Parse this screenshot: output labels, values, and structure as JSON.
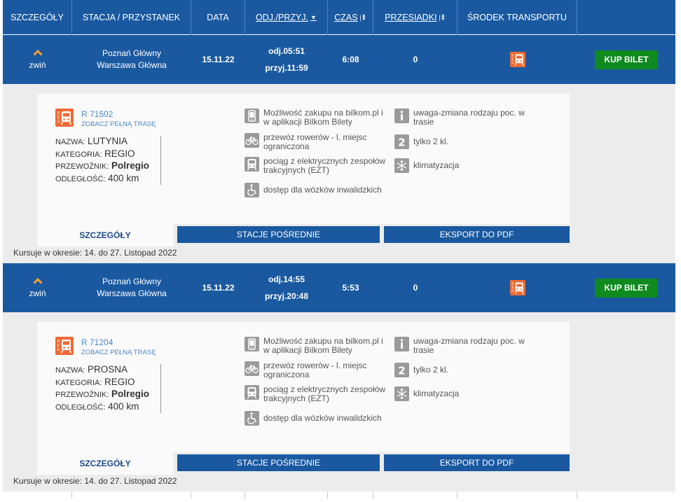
{
  "header": {
    "columns": [
      {
        "label": "SZCZEGÓŁY",
        "sortable": false
      },
      {
        "label": "STACJA / PRZYSTANEK",
        "sortable": false
      },
      {
        "label": "DATA",
        "sortable": false
      },
      {
        "label": "ODJ./PRZYJ.",
        "sortable": true,
        "arrow": "▼"
      },
      {
        "label": "CZAS",
        "sortable": true,
        "arrow": "▲▼"
      },
      {
        "label": "PRZESIADKI",
        "sortable": true,
        "arrow": "▲▼"
      },
      {
        "label": "ŚRODEK TRANSPORTU",
        "sortable": false
      },
      {
        "label": "",
        "sortable": false
      }
    ]
  },
  "colors": {
    "primary": "#1a59a0",
    "buy": "#0e8a1e",
    "link": "#4b87c7",
    "regio": "#ee6b35"
  },
  "trips": [
    {
      "collapse_label": "zwiń",
      "from": "Poznań Główny",
      "to": "Warszawa Główna",
      "date": "15.11.22",
      "departure": "odj.05:51",
      "arrival": "przyj.11:59",
      "duration": "6:08",
      "changes": "0",
      "transport_icon": "regio-train-icon",
      "buy_label": "KUP BILET",
      "details": {
        "train_number": "R 71502",
        "route_link": "ZOBACZ PEŁNĄ TRASĘ",
        "name_label": "NAZWA:",
        "name": "LUTYNIA",
        "category_label": "KATEGORIA:",
        "category": "REGIO",
        "carrier_label": "PRZEWOŹNIK:",
        "carrier": "Polregio",
        "distance_label": "ODLEGŁOŚĆ:",
        "distance": "400  km",
        "features": [
          {
            "icon": "mobile-phone-icon",
            "text": "Możliwość zakupu na bilkom.pl i w aplikacji Bilkom Bilety"
          },
          {
            "icon": "bicycle-icon",
            "text": "przewóz rowerów - l. miejsc ograniczona"
          },
          {
            "icon": "ezt-train-icon",
            "text": "pociąg z elektrycznych zespołów trakcyjnych (EZT)"
          },
          {
            "icon": "wheelchair-icon",
            "text": "dostęp dla wózków inwalidzkich"
          },
          {
            "icon": "info-icon",
            "text": "uwaga-zmiana rodzaju poc. w trasie"
          },
          {
            "icon": "second-class-icon",
            "text": "tylko 2 kl."
          },
          {
            "icon": "snowflake-icon",
            "text": "klimatyzacja"
          }
        ],
        "tabs": {
          "details": "SZCZEGÓŁY",
          "stations": "STACJE POŚREDNIE",
          "pdf": "EKSPORT DO PDF"
        },
        "period": "Kursuje w okresie: 14. do 27. Listopad 2022"
      }
    },
    {
      "collapse_label": "zwiń",
      "from": "Poznań Główny",
      "to": "Warszawa Główna",
      "date": "15.11.22",
      "departure": "odj.14:55",
      "arrival": "przyj.20:48",
      "duration": "5:53",
      "changes": "0",
      "transport_icon": "regio-train-icon",
      "buy_label": "KUP BILET",
      "details": {
        "train_number": "R 71204",
        "route_link": "ZOBACZ PEŁNĄ TRASĘ",
        "name_label": "NAZWA:",
        "name": "PROSNA",
        "category_label": "KATEGORIA:",
        "category": "REGIO",
        "carrier_label": "PRZEWOŹNIK:",
        "carrier": "Polregio",
        "distance_label": "ODLEGŁOŚĆ:",
        "distance": "400  km",
        "features": [
          {
            "icon": "mobile-phone-icon",
            "text": "Możliwość zakupu na bilkom.pl i w aplikacji Bilkom Bilety"
          },
          {
            "icon": "bicycle-icon",
            "text": "przewóz rowerów - l. miejsc ograniczona"
          },
          {
            "icon": "ezt-train-icon",
            "text": "pociąg z elektrycznych zespołów trakcyjnych (EZT)"
          },
          {
            "icon": "wheelchair-icon",
            "text": "dostęp dla wózków inwalidzkich"
          },
          {
            "icon": "info-icon",
            "text": "uwaga-zmiana rodzaju poc. w trasie"
          },
          {
            "icon": "second-class-icon",
            "text": "tylko 2 kl."
          },
          {
            "icon": "snowflake-icon",
            "text": "klimatyzacja"
          }
        ],
        "tabs": {
          "details": "SZCZEGÓŁY",
          "stations": "STACJE POŚREDNIE",
          "pdf": "EKSPORT DO PDF"
        },
        "period": "Kursuje w okresie: 14. do 27. Listopad 2022"
      }
    }
  ]
}
